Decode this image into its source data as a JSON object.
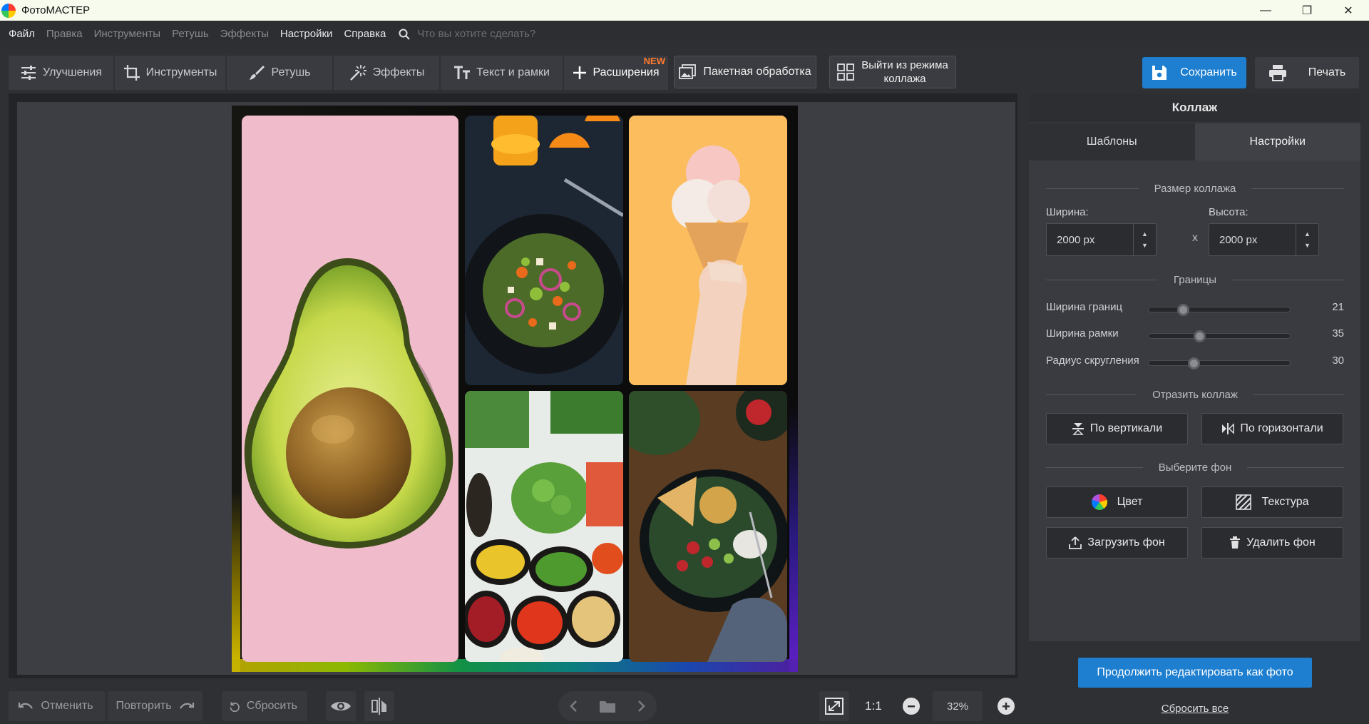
{
  "window": {
    "title": "ФотоМАСТЕР",
    "minimize": "—",
    "maximize": "❐",
    "close": "✕"
  },
  "menu": {
    "items": [
      "Файл",
      "Правка",
      "Инструменты",
      "Ретушь",
      "Эффекты",
      "Настройки",
      "Справка"
    ],
    "search_placeholder": "Что вы хотите сделать?"
  },
  "toolbar": {
    "tabs": [
      {
        "label": "Улучшения",
        "icon": "sliders-icon"
      },
      {
        "label": "Инструменты",
        "icon": "crop-icon"
      },
      {
        "label": "Ретушь",
        "icon": "brush-icon"
      },
      {
        "label": "Эффекты",
        "icon": "magic-wand-icon"
      },
      {
        "label": "Текст и рамки",
        "icon": "text-icon"
      },
      {
        "label": "Расширения",
        "icon": "plus-icon",
        "badge": "NEW"
      }
    ],
    "batch_label": "Пакетная обработка",
    "exit_collage_line1": "Выйти из режима",
    "exit_collage_line2": "коллажа",
    "save_label": "Сохранить",
    "print_label": "Печать"
  },
  "panel": {
    "title": "Коллаж",
    "tabs": [
      "Шаблоны",
      "Настройки"
    ],
    "active_tab": "Настройки",
    "size_section": "Размер коллажа",
    "width_label": "Ширина:",
    "width_value": "2000 px",
    "height_label": "Высота:",
    "height_value": "2000 px",
    "times": "x",
    "borders_section": "Границы",
    "sliders": [
      {
        "label": "Ширина границ",
        "value": "21",
        "fraction": 0.24
      },
      {
        "label": "Ширина рамки",
        "value": "35",
        "fraction": 0.36
      },
      {
        "label": "Радиус скругления",
        "value": "30",
        "fraction": 0.32
      }
    ],
    "reflect_section": "Отразить коллаж",
    "vertical_label": "По вертикали",
    "horizontal_label": "По горизонтали",
    "background_section": "Выберите фон",
    "color_label": "Цвет",
    "texture_label": "Текстура",
    "upload_label": "Загрузить фон",
    "delete_label": "Удалить фон"
  },
  "continue_label": "Продолжить редактировать как фото",
  "reset_all_label": "Сбросить все",
  "bottom": {
    "undo_label": "Отменить",
    "redo_label": "Повторить",
    "reset_label": "Сбросить",
    "one_to_one": "1:1",
    "zoom": "32%"
  },
  "colors": {
    "accent": "#1e7fd0",
    "badge": "#ff7a2e",
    "background": "#2f3034"
  }
}
